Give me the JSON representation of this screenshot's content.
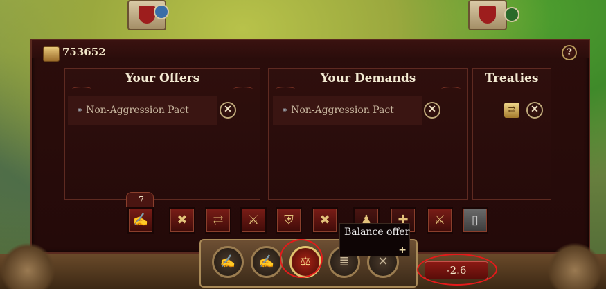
{
  "resources": {
    "gold": "753652"
  },
  "help_label": "?",
  "offers": {
    "title": "Your Offers",
    "items": [
      {
        "icon": "handshake-icon",
        "label": "Non-Aggression Pact"
      }
    ]
  },
  "demands": {
    "title": "Your Demands",
    "items": [
      {
        "icon": "handshake-icon",
        "label": "Non-Aggression Pact"
      }
    ]
  },
  "treaties": {
    "title": "Treaties",
    "items": [
      {
        "icon": "treaty-scroll-icon"
      }
    ]
  },
  "remove_glyph": "✕",
  "treaty_toolbar": {
    "cost_label": "-7",
    "buttons": [
      {
        "name": "pact-scroll-icon",
        "glyph": "✍"
      },
      {
        "name": "broken-handshake-icon",
        "glyph": "✖"
      },
      {
        "name": "trade-cancel-icon",
        "glyph": "⇄"
      },
      {
        "name": "war-cancel-icon",
        "glyph": "⚔"
      },
      {
        "name": "shield-cancel-icon",
        "glyph": "⛨"
      },
      {
        "name": "alliance-cancel-icon",
        "glyph": "✖"
      },
      {
        "name": "vassal-icon",
        "glyph": "♟"
      },
      {
        "name": "defense-icon",
        "glyph": "✚"
      },
      {
        "name": "crossed-swords-icon",
        "glyph": "⚔"
      },
      {
        "name": "locked-treaty-icon",
        "glyph": "▯"
      }
    ]
  },
  "action_bar": {
    "buttons": [
      {
        "name": "propose-icon",
        "glyph": "✍"
      },
      {
        "name": "counter-offer-icon",
        "glyph": "✍"
      },
      {
        "name": "balance-offer-icon",
        "glyph": "⚖"
      },
      {
        "name": "scroll-list-icon",
        "glyph": "≣"
      },
      {
        "name": "cancel-icon",
        "glyph": "✕"
      }
    ]
  },
  "tooltip": {
    "label": "Balance offer",
    "plus": "+"
  },
  "balance_value": "-2.6",
  "colors": {
    "panel": "#2b0d0b",
    "accent_gold": "#bfa97a",
    "annotation_red": "#e51a1a"
  }
}
